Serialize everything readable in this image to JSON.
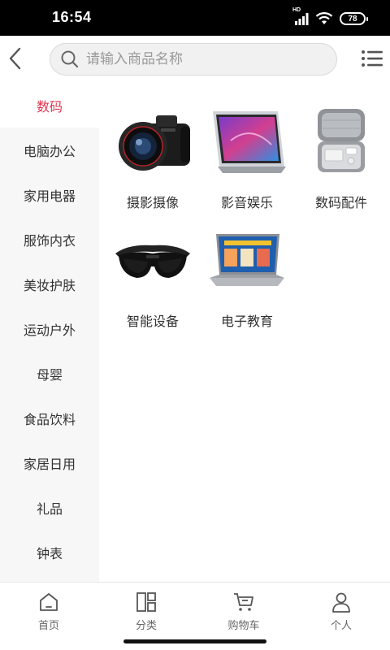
{
  "status_bar": {
    "time": "16:54",
    "network": "HD",
    "battery": "78"
  },
  "search": {
    "placeholder": "请输入商品名称",
    "value": ""
  },
  "sidebar": {
    "items": [
      {
        "label": "数码",
        "active": true
      },
      {
        "label": "电脑办公"
      },
      {
        "label": "家用电器"
      },
      {
        "label": "服饰内衣"
      },
      {
        "label": "美妆护肤"
      },
      {
        "label": "运动户外"
      },
      {
        "label": "母婴"
      },
      {
        "label": "食品饮料"
      },
      {
        "label": "家居日用"
      },
      {
        "label": "礼品"
      },
      {
        "label": "钟表"
      }
    ]
  },
  "categories": [
    {
      "label": "摄影摄像",
      "icon": "camera-image"
    },
    {
      "label": "影音娱乐",
      "icon": "tablet-image"
    },
    {
      "label": "数码配件",
      "icon": "accessory-case-image"
    },
    {
      "label": "智能设备",
      "icon": "vr-glasses-image"
    },
    {
      "label": "电子教育",
      "icon": "education-laptop-image"
    }
  ],
  "tabbar": {
    "items": [
      {
        "label": "首页",
        "icon": "home-icon"
      },
      {
        "label": "分类",
        "icon": "category-icon"
      },
      {
        "label": "购物车",
        "icon": "cart-icon"
      },
      {
        "label": "个人",
        "icon": "user-icon"
      }
    ]
  },
  "colors": {
    "accent": "#e0374f",
    "sidebar_bg": "#f7f7f7",
    "status_bar": "#000000"
  }
}
